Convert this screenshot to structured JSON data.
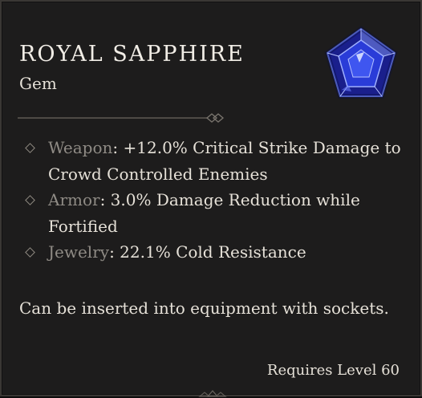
{
  "item": {
    "name": "ROYAL SAPPHIRE",
    "type": "Gem",
    "icon": "sapphire-gem-icon",
    "affixes": [
      {
        "slot": "Weapon",
        "effect": ": +12.0% Critical Strike Damage to Crowd Controlled Enemies"
      },
      {
        "slot": "Armor",
        "effect": ": 3.0% Damage Reduction while Fortified"
      },
      {
        "slot": "Jewelry",
        "effect": ": 22.1% Cold Resistance"
      }
    ],
    "description": "Can be inserted into equipment with sockets.",
    "requirement": "Requires Level 60"
  },
  "colors": {
    "background": "#1d1c1c",
    "title": "#f1ede6",
    "text": "#e6e1d8",
    "affix_label": "#8f8b85",
    "gem_blue": "#2a3cd8"
  }
}
